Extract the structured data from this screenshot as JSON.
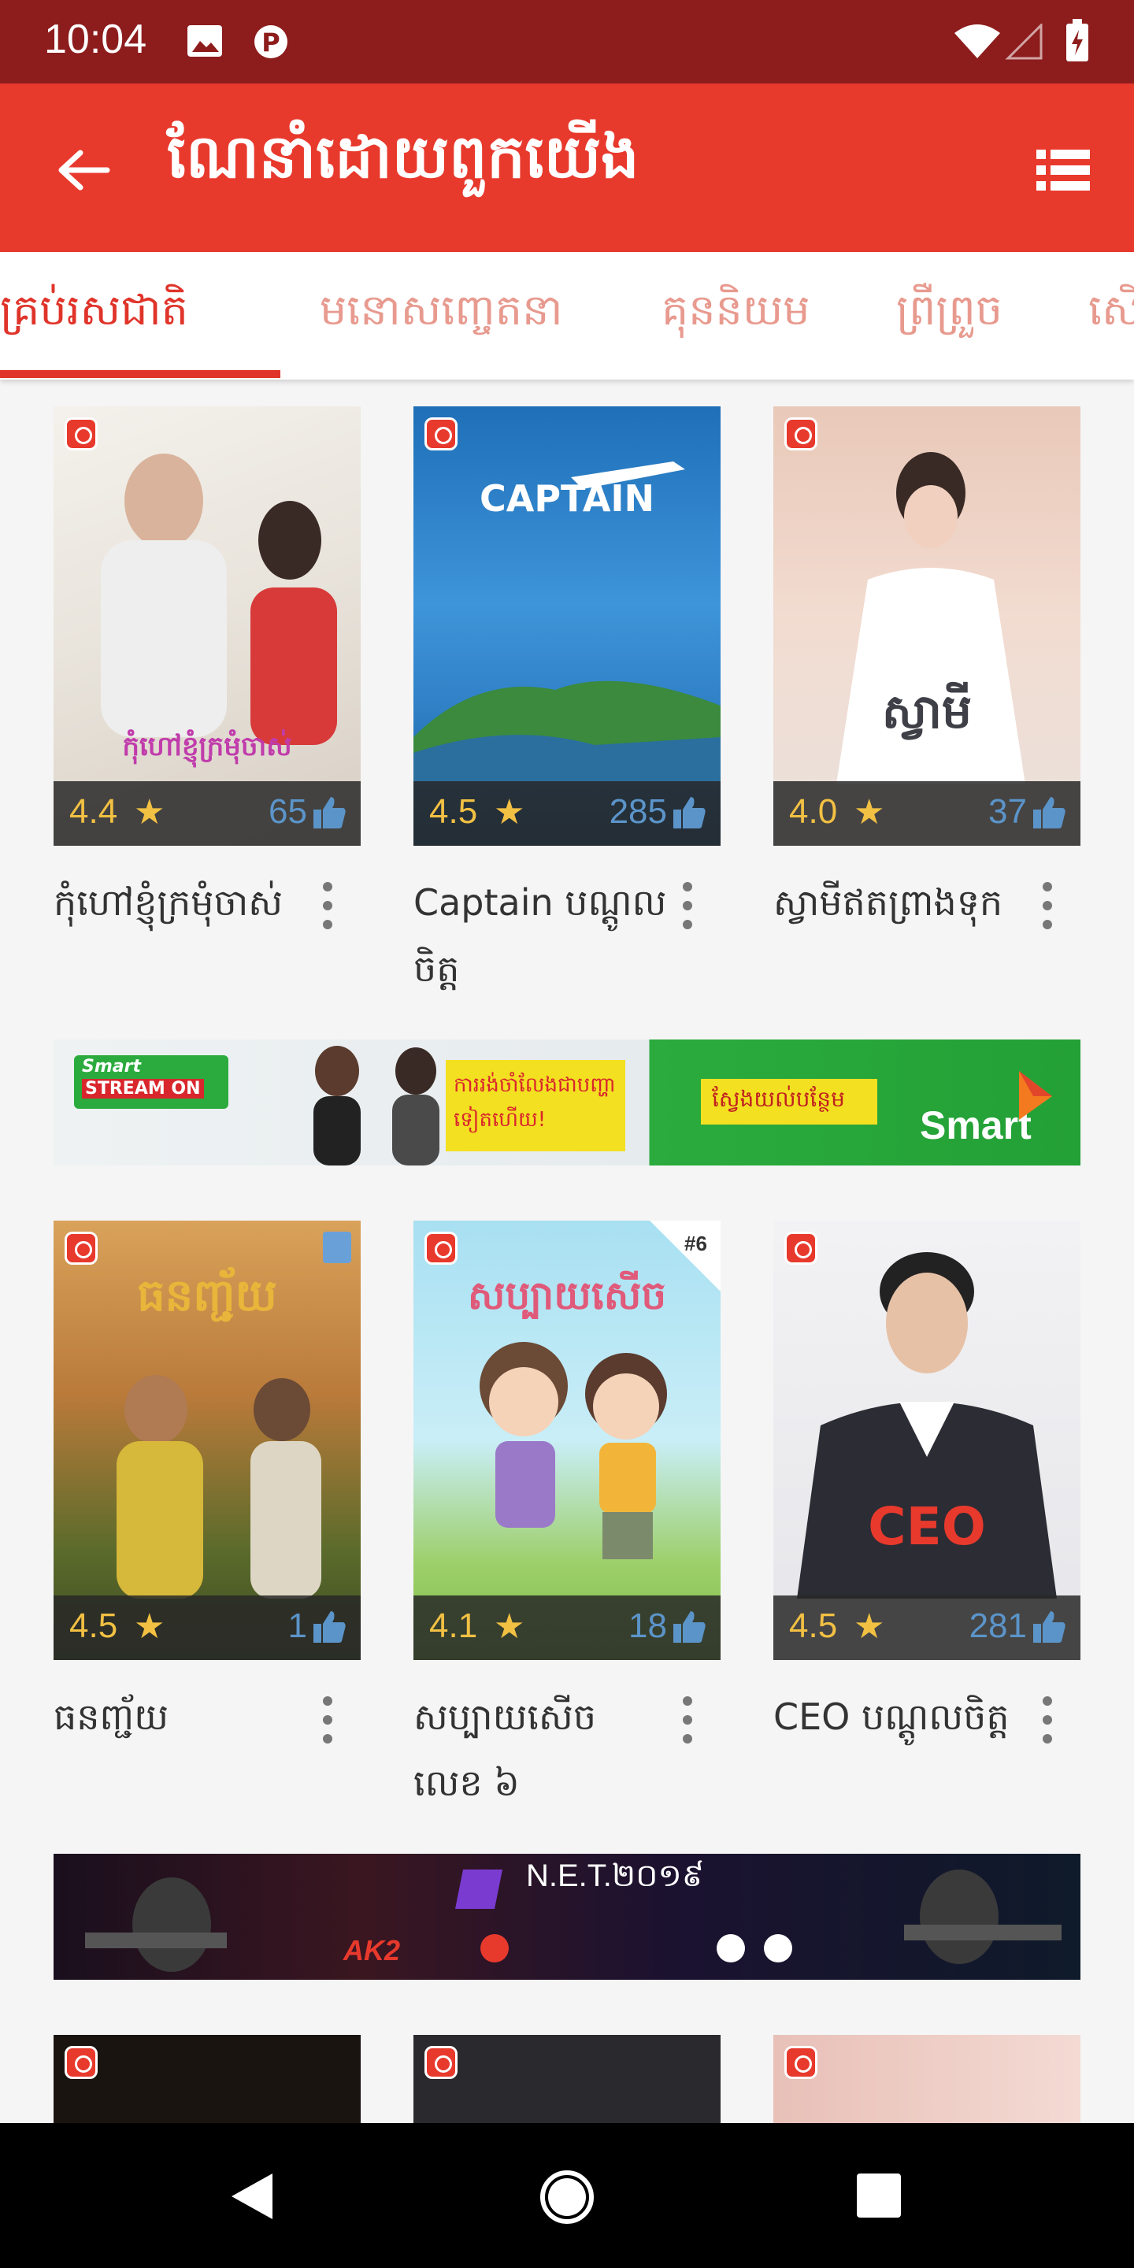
{
  "status_bar": {
    "time": "10:04"
  },
  "app_bar": {
    "title": "ណែនាំដោយពួកយើង"
  },
  "tabs": [
    {
      "label": "គ្រប់រសជាតិ"
    },
    {
      "label": "មនោសញ្ចេតនា"
    },
    {
      "label": "គុននិយម"
    },
    {
      "label": "ព្រឺព្រួច"
    },
    {
      "label": "សើ"
    }
  ],
  "books": [
    {
      "title": "កុំហៅខ្ញុំក្រមុំចាស់",
      "rating": "4.4",
      "likes": "65",
      "cover_text": "កុំហៅខ្ញុំក្រមុំចាស់"
    },
    {
      "title": "Captain បណ្តូលចិត្ត",
      "rating": "4.5",
      "likes": "285",
      "cover_text": "CAPTAIN"
    },
    {
      "title": "ស្វាមីឥតព្រាងទុក",
      "rating": "4.0",
      "likes": "37",
      "cover_text": "ស្វាមី"
    },
    {
      "title": "ធនញ្ជ័យ",
      "rating": "4.5",
      "likes": "1",
      "cover_text": "ធនញ្ជ័យ"
    },
    {
      "title": "សប្បាយសើច លេខ ៦",
      "rating": "4.1",
      "likes": "18",
      "cover_text": "សប្បាយសើច",
      "cover_tag": "#6"
    },
    {
      "title": "CEO បណ្តូលចិត្ត",
      "rating": "4.5",
      "likes": "281",
      "cover_text": "CEO"
    }
  ],
  "banners": {
    "smart": {
      "brand": "Smart",
      "product": "STREAM ON",
      "text": "ការរង់ចាំលែងជាបញ្ហាទៀតហើយ!",
      "cta": "ស្វែងយល់បន្ថែម"
    },
    "net": {
      "title": "N.E.T.២០១៩",
      "sponsor": "AK2"
    }
  },
  "colors": {
    "primary": "#e8392d",
    "status_bar": "#8d1c1c",
    "rating": "#f2c043",
    "likes": "#5b94c9"
  }
}
